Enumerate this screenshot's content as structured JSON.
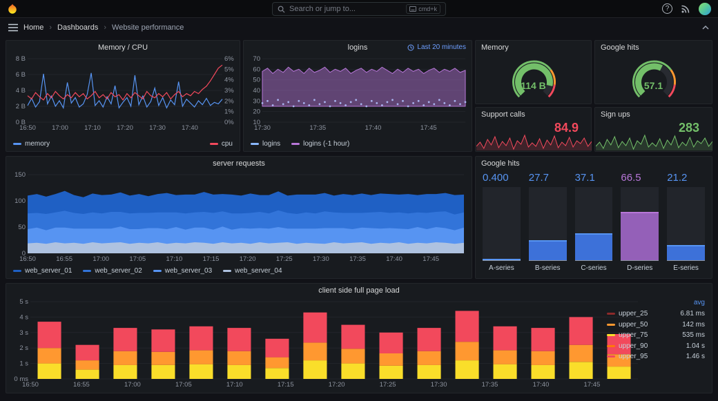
{
  "topnav": {
    "search_placeholder": "Search or jump to...",
    "shortcut": "cmd+k"
  },
  "breadcrumb": {
    "items": [
      "Home",
      "Dashboards",
      "Website performance"
    ]
  },
  "panels": {
    "memory_cpu": {
      "title": "Memory / CPU",
      "y_left": [
        "8 B",
        "6 B",
        "4 B",
        "2 B",
        "0 B"
      ],
      "y_right": [
        "6%",
        "5%",
        "4%",
        "3%",
        "2%",
        "1%",
        "0%"
      ],
      "x_ticks": [
        "16:50",
        "17:00",
        "17:10",
        "17:20",
        "17:30",
        "17:40"
      ],
      "y_left_max": 8,
      "y_right_max": 6,
      "legend": [
        {
          "label": "memory",
          "color": "#5794f2"
        },
        {
          "label": "cpu",
          "color": "#f2495c"
        }
      ],
      "series": {
        "memory": [
          2.1,
          3.0,
          1.9,
          2.6,
          6.1,
          2.3,
          3.3,
          2.0,
          2.7,
          1.8,
          5.0,
          2.4,
          3.1,
          1.9,
          2.3,
          3.5,
          6.2,
          2.1,
          2.7,
          1.9,
          3.2,
          2.3,
          4.6,
          1.8,
          2.5,
          3.1,
          2.0,
          5.9,
          2.2,
          3.3,
          1.9,
          2.6,
          4.3,
          2.1,
          3.1,
          1.8,
          2.8,
          2.2,
          5.1,
          2.0,
          2.9,
          2.4,
          1.9,
          2.7,
          2.2,
          3.0,
          2.1,
          2.5,
          2.3,
          2.9
        ],
        "cpu": [
          2.5,
          2.2,
          2.8,
          2.4,
          2.1,
          2.7,
          2.3,
          2.9,
          2.5,
          2.2,
          2.6,
          2.3,
          2.8,
          2.4,
          2.7,
          2.2,
          2.5,
          2.9,
          2.3,
          2.6,
          2.2,
          2.8,
          2.4,
          2.6,
          2.1,
          2.7,
          2.3,
          2.8,
          2.5,
          2.2,
          2.9,
          2.5,
          2.3,
          2.7,
          2.4,
          2.8,
          2.2,
          2.6,
          2.9,
          2.4,
          2.7,
          2.5,
          2.9,
          2.7,
          3.1,
          3.4,
          3.9,
          4.5,
          5.1,
          5.4
        ]
      }
    },
    "logins": {
      "title": "logins",
      "time_range": "Last 20 minutes",
      "y_ticks": [
        "70",
        "60",
        "50",
        "40",
        "30",
        "20",
        "10"
      ],
      "x_ticks": [
        "17:30",
        "17:35",
        "17:40",
        "17:45"
      ],
      "y_min": 10,
      "y_max": 70,
      "legend": [
        {
          "label": "logins",
          "color": "#8ab8ff"
        },
        {
          "label": "logins (-1 hour)",
          "color": "#b877d9"
        }
      ],
      "series": {
        "area": [
          58,
          61,
          56,
          60,
          57,
          62,
          58,
          60,
          56,
          61,
          57,
          59,
          62,
          57,
          60,
          58,
          61,
          56,
          59,
          61,
          57,
          60,
          58,
          62,
          59,
          56,
          60,
          57,
          61,
          58,
          60,
          56,
          59,
          61,
          57,
          60,
          58,
          61,
          57,
          59
        ],
        "area_base": 25,
        "dots": [
          28,
          30,
          26,
          31,
          27,
          29,
          25,
          30,
          28,
          26,
          31,
          27,
          29,
          25,
          30,
          28,
          26,
          29,
          31,
          27,
          25,
          30,
          28,
          26,
          29,
          31,
          27,
          30,
          25,
          28,
          30,
          26,
          29,
          27,
          31,
          28,
          26,
          30,
          27,
          29
        ]
      }
    },
    "memory_gauge": {
      "title": "Memory",
      "value": "114 B",
      "fraction": 0.88,
      "color": "#73bf69"
    },
    "google_hits_gauge": {
      "title": "Google hits",
      "value": "57.1",
      "fraction": 0.6,
      "color": "#73bf69"
    },
    "support_calls": {
      "title": "Support calls",
      "value": "84.9",
      "color": "#f2495c",
      "fill": "rgba(242,73,92,0.18)",
      "spark": [
        58,
        64,
        55,
        68,
        60,
        72,
        56,
        65,
        59,
        70,
        54,
        66,
        61,
        74,
        57,
        63,
        58,
        69,
        55,
        67,
        60,
        73,
        56,
        64,
        59,
        71,
        57,
        66,
        62,
        70,
        58,
        65
      ]
    },
    "sign_ups": {
      "title": "Sign ups",
      "value": "283",
      "color": "#73bf69",
      "fill": "rgba(115,191,105,0.18)",
      "spark": [
        60,
        66,
        57,
        70,
        62,
        74,
        58,
        67,
        61,
        72,
        56,
        68,
        63,
        76,
        59,
        65,
        60,
        71,
        57,
        69,
        62,
        75,
        58,
        66,
        61,
        73,
        59,
        68,
        64,
        72,
        60,
        67
      ]
    },
    "server_requests": {
      "title": "server requests",
      "y_ticks": [
        "150",
        "100",
        "50",
        "0"
      ],
      "x_ticks": [
        "16:50",
        "16:55",
        "17:00",
        "17:05",
        "17:10",
        "17:15",
        "17:20",
        "17:25",
        "17:30",
        "17:35",
        "17:40",
        "17:45"
      ],
      "y_max": 150,
      "legend": [
        {
          "label": "web_server_01",
          "color": "#1f60c4"
        },
        {
          "label": "web_server_02",
          "color": "#3274d9"
        },
        {
          "label": "web_server_03",
          "color": "#5794f2"
        },
        {
          "label": "web_server_04",
          "color": "#aec2e0"
        }
      ],
      "series": {
        "web_server_01": [
          34,
          36,
          33,
          35,
          38,
          34,
          32,
          36,
          35,
          33,
          37,
          34,
          36,
          32,
          35,
          37,
          33,
          36,
          34,
          38,
          35,
          33,
          36,
          34,
          37,
          32,
          35,
          36,
          33,
          37,
          34,
          36,
          35,
          32,
          36,
          34,
          37,
          33,
          35,
          36,
          34,
          37,
          33,
          36,
          34,
          35,
          37,
          34
        ],
        "web_server_02": [
          30,
          28,
          31,
          29,
          32,
          30,
          28,
          31,
          29,
          32,
          28,
          30,
          31,
          29,
          30,
          32,
          28,
          31,
          29,
          30,
          32,
          29,
          31,
          28,
          30,
          31,
          29,
          32,
          30,
          28,
          31,
          29,
          32,
          30,
          29,
          31,
          28,
          30,
          32,
          29,
          31,
          30,
          28,
          31,
          29,
          32,
          30,
          29
        ],
        "web_server_03": [
          27,
          29,
          26,
          28,
          30,
          27,
          29,
          26,
          28,
          27,
          30,
          28,
          26,
          29,
          27,
          28,
          30,
          26,
          28,
          29,
          27,
          30,
          26,
          28,
          29,
          27,
          28,
          30,
          26,
          29,
          27,
          28,
          30,
          27,
          29,
          26,
          28,
          30,
          27,
          29,
          26,
          28,
          30,
          27,
          29,
          28,
          26,
          29
        ],
        "web_server_04": [
          19,
          20,
          18,
          21,
          19,
          20,
          18,
          21,
          19,
          20,
          21,
          18,
          20,
          19,
          21,
          18,
          20,
          19,
          21,
          20,
          18,
          21,
          19,
          20,
          18,
          21,
          19,
          20,
          21,
          18,
          20,
          19,
          18,
          21,
          19,
          20,
          21,
          18,
          20,
          19,
          21,
          18,
          20,
          19,
          21,
          20,
          18,
          20
        ]
      }
    },
    "google_hits_bars": {
      "title": "Google hits",
      "max": 100,
      "items": [
        {
          "value": "0.400",
          "num": 0.4,
          "label": "A-series",
          "color": "#5794f2",
          "fill": "#3d71d9"
        },
        {
          "value": "27.7",
          "num": 27.7,
          "label": "B-series",
          "color": "#5794f2",
          "fill": "#3d71d9"
        },
        {
          "value": "37.1",
          "num": 37.1,
          "label": "C-series",
          "color": "#5794f2",
          "fill": "#3d71d9"
        },
        {
          "value": "66.5",
          "num": 66.5,
          "label": "D-series",
          "color": "#b877d9",
          "fill": "#9460b8"
        },
        {
          "value": "21.2",
          "num": 21.2,
          "label": "E-series",
          "color": "#5794f2",
          "fill": "#3d71d9"
        }
      ]
    },
    "page_load": {
      "title": "client side full page load",
      "y_ticks": [
        "5 s",
        "4 s",
        "3 s",
        "2 s",
        "1 s",
        "0 ms"
      ],
      "x_ticks": [
        "16:50",
        "16:55",
        "17:00",
        "17:05",
        "17:10",
        "17:15",
        "17:20",
        "17:25",
        "17:30",
        "17:35",
        "17:40",
        "17:45"
      ],
      "y_max": 5,
      "segment_colors": [
        "#fade2a",
        "#ff9830",
        "#f2495c"
      ],
      "bars": [
        [
          1.0,
          1.0,
          1.7
        ],
        [
          0.6,
          0.6,
          1.0
        ],
        [
          0.9,
          0.9,
          1.5
        ],
        [
          0.9,
          0.85,
          1.45
        ],
        [
          0.95,
          0.9,
          1.55
        ],
        [
          0.9,
          0.9,
          1.5
        ],
        [
          0.7,
          0.7,
          1.2
        ],
        [
          1.2,
          1.15,
          1.95
        ],
        [
          1.0,
          0.95,
          1.55
        ],
        [
          0.85,
          0.8,
          1.35
        ],
        [
          0.9,
          0.9,
          1.5
        ],
        [
          1.2,
          1.2,
          2.0
        ],
        [
          0.95,
          0.9,
          1.55
        ],
        [
          0.9,
          0.9,
          1.5
        ],
        [
          1.1,
          1.1,
          1.8
        ],
        [
          0.8,
          0.8,
          1.3
        ]
      ],
      "legend_header": "avg",
      "legend": [
        {
          "label": "upper_25",
          "avg": "6.81 ms",
          "color": "#8c2a2a"
        },
        {
          "label": "upper_50",
          "avg": "142 ms",
          "color": "#ff9830"
        },
        {
          "label": "upper_75",
          "avg": "535 ms",
          "color": "#fade2a"
        },
        {
          "label": "upper_90",
          "avg": "1.04 s",
          "color": "#ff780a"
        },
        {
          "label": "upper_95",
          "avg": "1.46 s",
          "color": "#f2495c"
        }
      ]
    }
  }
}
